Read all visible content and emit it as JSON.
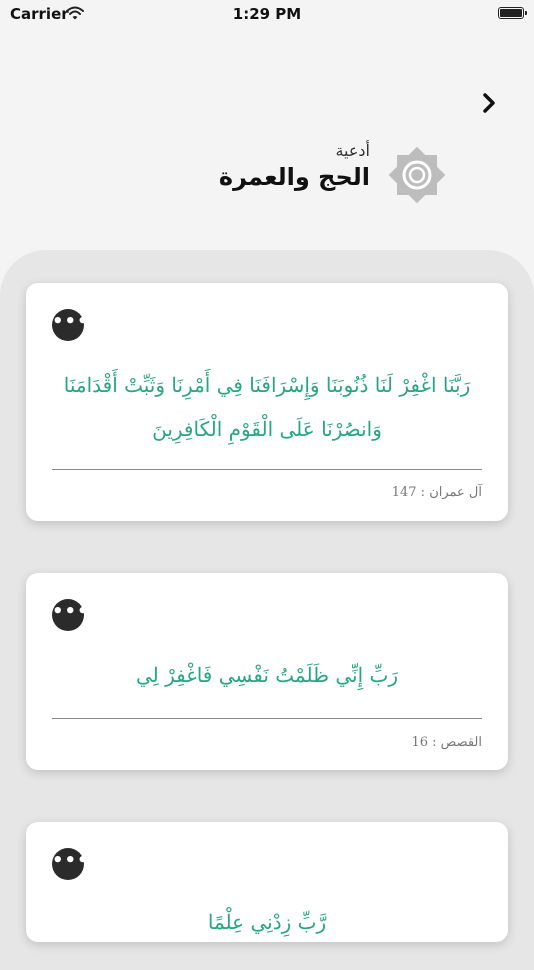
{
  "status": {
    "carrier": "Carrier",
    "time": "1:29 PM"
  },
  "header": {
    "subtitle": "أدعية",
    "title": "الحج والعمرة"
  },
  "cards": [
    {
      "verse": "رَبَّنَا اغْفِرْ لَنَا ذُنُوبَنَا وَإِسْرَافَنَا فِي أَمْرِنَا وَثَبِّتْ أَقْدَامَنَا وَانصُرْنَا عَلَى الْقَوْمِ الْكَافِرِينَ",
      "reference": "آل عمران : 147"
    },
    {
      "verse": "رَبِّ إِنِّي ظَلَمْتُ نَفْسِي فَاغْفِرْ لِي",
      "reference": "القصص : 16"
    },
    {
      "verse": "رَّبِّ زِدْنِي عِلْمًا",
      "reference": ""
    }
  ],
  "more_label": "•••",
  "colors": {
    "verse": "#27a683",
    "sheet": "#e6e6e6",
    "more_button": "#2b2b2b"
  }
}
